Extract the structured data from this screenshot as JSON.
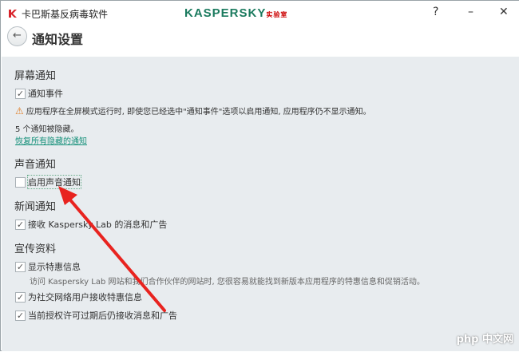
{
  "titlebar": {
    "app_title": "卡巴斯基反病毒软件",
    "logo": "KASPERSKY",
    "logo_suffix": "实验室",
    "help": "?",
    "minimize": "–",
    "close": "✕"
  },
  "header": {
    "back": "←",
    "title": "通知设置"
  },
  "screen": {
    "heading": "屏幕通知",
    "notify_events": "通知事件",
    "warning": "应用程序在全屏模式运行时, 即使您已经选中\"通知事件\"选项以启用通知, 应用程序仍不显示通知。",
    "hidden_count": "5 个通知被隐藏。",
    "restore_link": "恢复所有隐藏的通知"
  },
  "sound": {
    "heading": "声音通知",
    "enable_sound": "启用声音通知"
  },
  "news": {
    "heading": "新闻通知",
    "receive_news": "接收 Kaspersky Lab 的消息和广告"
  },
  "promo": {
    "heading": "宣传资料",
    "show_offers": "显示特惠信息",
    "offers_desc": "访问 Kaspersky Lab 网站和我们合作伙伴的网站时, 您很容易就能找到新版本应用程序的特惠信息和促销活动。",
    "social_offers": "为社交网络用户接收特惠信息",
    "after_expiry": "当前授权许可过期后仍接收消息和广告"
  },
  "checked": "✓",
  "watermark": "php 中文网"
}
